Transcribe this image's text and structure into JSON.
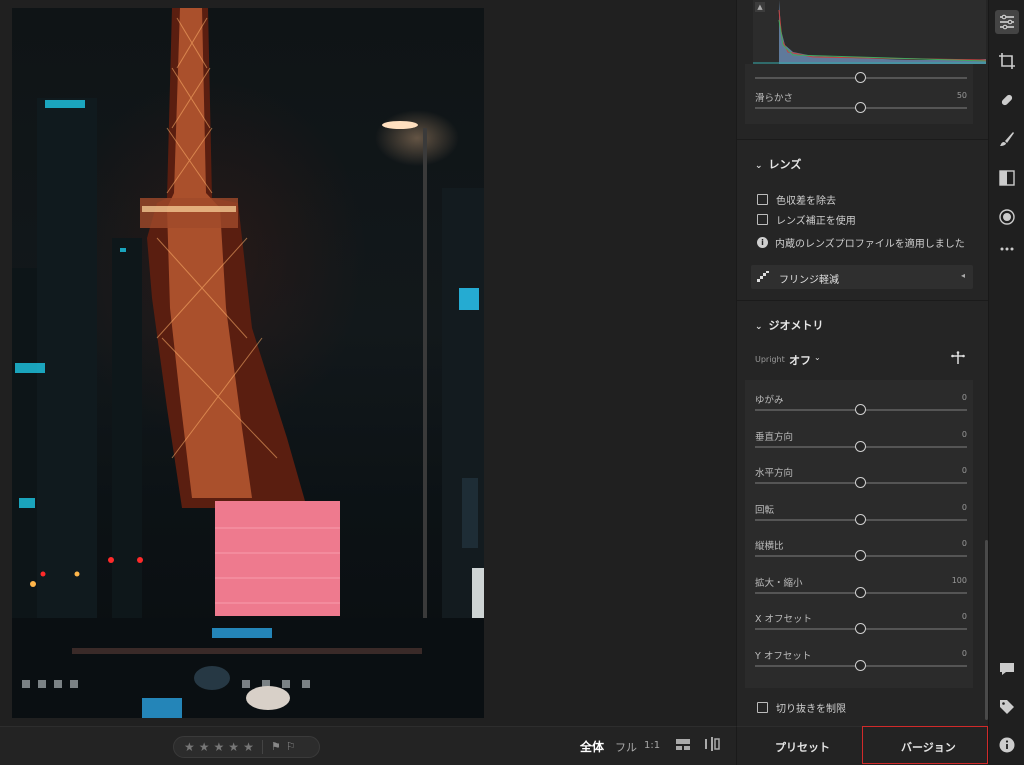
{
  "bottom_bar": {
    "stars": [
      "★",
      "★",
      "★",
      "★",
      "★"
    ],
    "flags": [
      "⚑",
      "⚐"
    ],
    "view_fit": "全体",
    "view_fill": "フル",
    "view_1to1": "1:1"
  },
  "panel": {
    "smoothness": {
      "label": "滑らかさ",
      "value": "50",
      "level": 0.5
    },
    "top_slider": {
      "level": 0.5
    },
    "lens": {
      "header": "レンズ",
      "remove_ca": "色収差を除去",
      "enable_profile": "レンズ補正を使用",
      "info": "内蔵のレンズプロファイルを適用しました",
      "defringe": "フリンジ軽減"
    },
    "geometry": {
      "header": "ジオメトリ",
      "upright_label": "Upright",
      "upright_value": "オフ",
      "sliders": [
        {
          "label": "ゆがみ",
          "value": "0",
          "level": 0.5
        },
        {
          "label": "垂直方向",
          "value": "0",
          "level": 0.5
        },
        {
          "label": "水平方向",
          "value": "0",
          "level": 0.5
        },
        {
          "label": "回転",
          "value": "0",
          "level": 0.5
        },
        {
          "label": "縦横比",
          "value": "0",
          "level": 0.5
        },
        {
          "label": "拡大・縮小",
          "value": "100",
          "level": 0.5
        },
        {
          "label": "X オフセット",
          "value": "0",
          "level": 0.5
        },
        {
          "label": "Y オフセット",
          "value": "0",
          "level": 0.5
        }
      ],
      "constrain_crop": "切り抜きを制限"
    }
  },
  "tabs": {
    "presets": "プリセット",
    "versions": "バージョン"
  },
  "colors": {
    "accent_highlight": "#d12a2a",
    "panel_bg": "#252525"
  },
  "icons": {
    "toolstrip": [
      "edit-sliders-icon",
      "crop-icon",
      "healing-icon",
      "brush-icon",
      "linear-gradient-icon",
      "radial-gradient-icon",
      "more-icon",
      "comment-icon",
      "tag-icon",
      "info-icon"
    ]
  }
}
